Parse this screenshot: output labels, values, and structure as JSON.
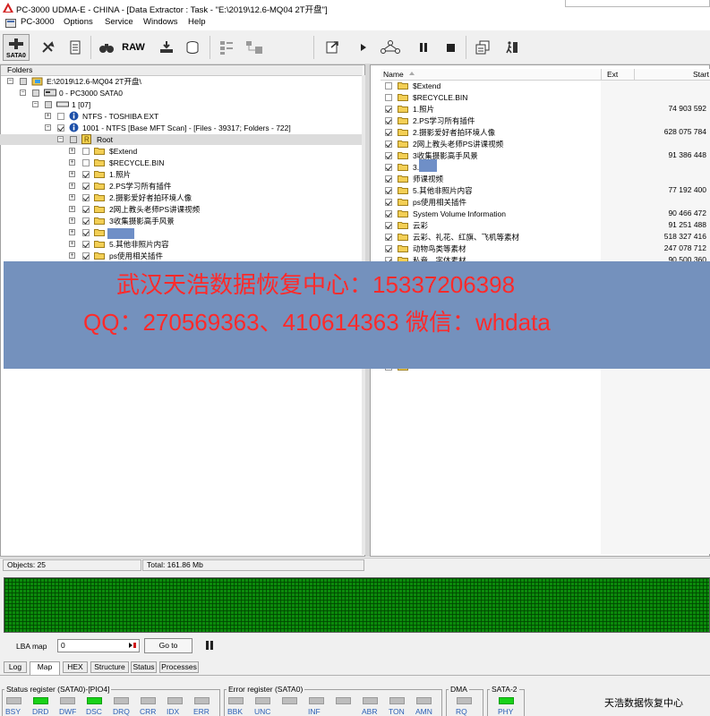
{
  "window": {
    "title": "PC-3000 UDMA-E - CHINA - [Data Extractor : Task - \"E:\\2019\\12.6-MQ04 2T开盘\"]"
  },
  "menu": {
    "items": [
      "PC-3000",
      "Options",
      "Service",
      "Windows",
      "Help"
    ]
  },
  "toolbar": {
    "sata_label": "SATA0",
    "raw_label": "RAW"
  },
  "folders_panel": {
    "header": "Folders",
    "rows": [
      {
        "label": "E:\\2019\\12.6-MQ04 2T开盘\\"
      },
      {
        "label": "0 - PC3000 SATA0"
      },
      {
        "label": "1 [07]"
      },
      {
        "label": "NTFS - TOSHIBA EXT"
      },
      {
        "label": "1001 - NTFS [Base MFT Scan] - [Files - 39317; Folders - 722]"
      },
      {
        "label": "Root"
      },
      {
        "label": "$Extend"
      },
      {
        "label": "$RECYCLE.BIN"
      },
      {
        "label": "1.照片"
      },
      {
        "label": "2.PS学习所有插件"
      },
      {
        "label": "2.摄影爱好者拍环境人像"
      },
      {
        "label": "2网上教头老师PS讲课视频"
      },
      {
        "label": "3收集摄影高手风景"
      },
      {
        "label": "课视频"
      },
      {
        "label": "5.其他非照片内容"
      },
      {
        "label": "ps使用相关插件"
      }
    ]
  },
  "files_panel": {
    "columns": {
      "name": "Name",
      "ext": "Ext",
      "start": "Start"
    },
    "rows": [
      {
        "name": "$Extend",
        "start": ""
      },
      {
        "name": "$RECYCLE.BIN",
        "start": ""
      },
      {
        "name": "1.照片",
        "start": "74 903 592"
      },
      {
        "name": "2.PS学习所有插件",
        "start": ""
      },
      {
        "name": "2.摄影爱好者拍环境人像",
        "start": "628 075 784"
      },
      {
        "name": "2网上教头老师PS讲课视频",
        "start": ""
      },
      {
        "name": "3收集摄影高手风景",
        "start": "91 386 448"
      },
      {
        "name": "3.",
        "start": ""
      },
      {
        "name": "师课视频",
        "start": ""
      },
      {
        "name": "5.其他非照片内容",
        "start": "77 192 400"
      },
      {
        "name": "ps使用相关插件",
        "start": ""
      },
      {
        "name": "System Volume Information",
        "start": "90 466 472"
      },
      {
        "name": "云彩",
        "start": "91 251 488"
      },
      {
        "name": "云彩、礼花、红旗、飞机等素材",
        "start": "518 327 416"
      },
      {
        "name": "动物鸟类等素材",
        "start": "247 078 712"
      },
      {
        "name": "私章、字体素材",
        "start": "90 500 360"
      }
    ]
  },
  "overlay": {
    "line1": "武汉天浩数据恢复中心：15337206398",
    "line2": "QQ：270569363、410614363   微信：whdata"
  },
  "status": {
    "objects": "Objects: 25",
    "total": "Total: 161.86 Mb"
  },
  "lba": {
    "label": "LBA map",
    "value": "0",
    "goto": "Go to"
  },
  "tabs": [
    "Log",
    "Map",
    "HEX",
    "Structure",
    "Status",
    "Processes"
  ],
  "registers": {
    "status_title": "Status register (SATA0)-[PIO4]",
    "status_leds": [
      "BSY",
      "DRD",
      "DWF",
      "DSC",
      "DRQ",
      "CRR",
      "IDX",
      "ERR"
    ],
    "error_title": "Error register (SATA0)",
    "error_leds": [
      "BBK",
      "UNC",
      "",
      "INF",
      "",
      "ABR",
      "TON",
      "AMN"
    ],
    "dma_title": "DMA",
    "dma_leds": [
      "RQ"
    ],
    "sata_title": "SATA-2",
    "sata_leds": [
      "PHY"
    ]
  },
  "watermark": "天浩数据恢复中心",
  "colors": {
    "overlay": "#7491bd",
    "overlay_text": "#ff2a2a",
    "led_on": "#19d219",
    "map": "#0b8a0b"
  }
}
